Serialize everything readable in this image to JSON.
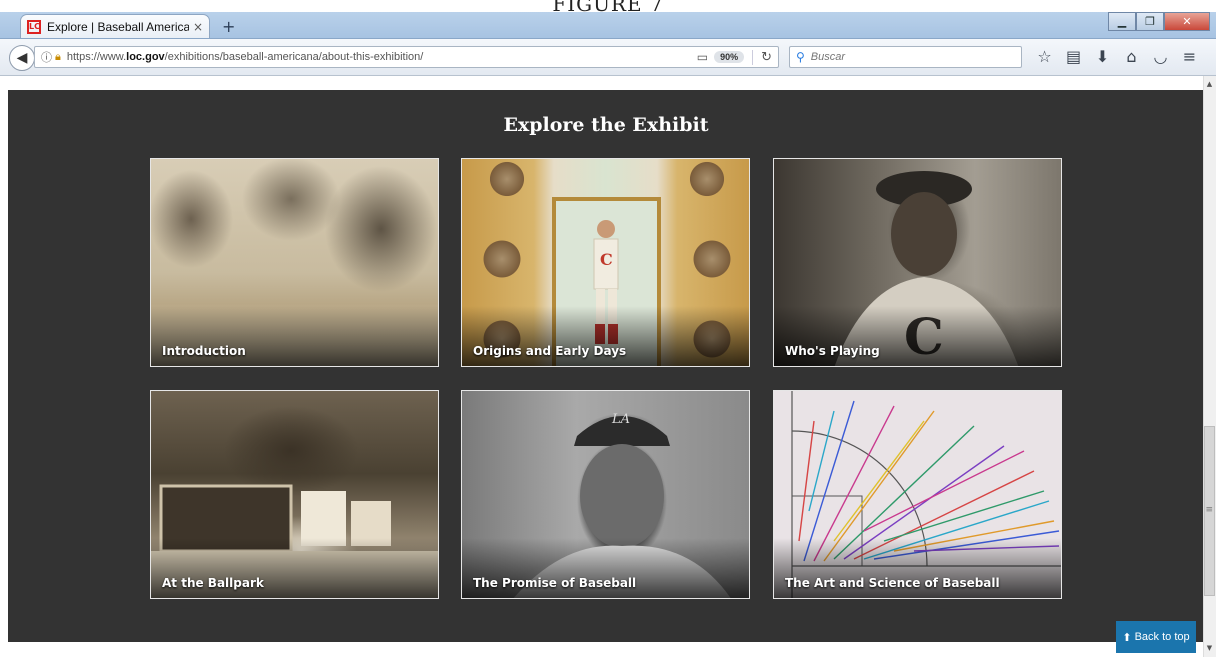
{
  "figure_caption": "FIGURE 7",
  "browser": {
    "tab_title": "Explore | Baseball America...",
    "tab_close": "×",
    "new_tab": "+",
    "favicon_text": "LC",
    "url_prefix": "https://www.",
    "url_domain": "loc.gov",
    "url_path": "/exhibitions/baseball-americana/about-this-exhibition/",
    "zoom": "90%",
    "search_placeholder": "Buscar"
  },
  "page": {
    "section_title": "Explore the Exhibit",
    "cards": [
      {
        "label": "Introduction"
      },
      {
        "label": "Origins and Early Days"
      },
      {
        "label": "Who's Playing"
      },
      {
        "label": "At the Ballpark"
      },
      {
        "label": "The Promise of Baseball"
      },
      {
        "label": "The Art and Science of Baseball"
      }
    ],
    "back_to_top": "Back to top"
  },
  "colors": {
    "section_bg": "#333333",
    "back_to_top_bg": "#1b75ad"
  }
}
